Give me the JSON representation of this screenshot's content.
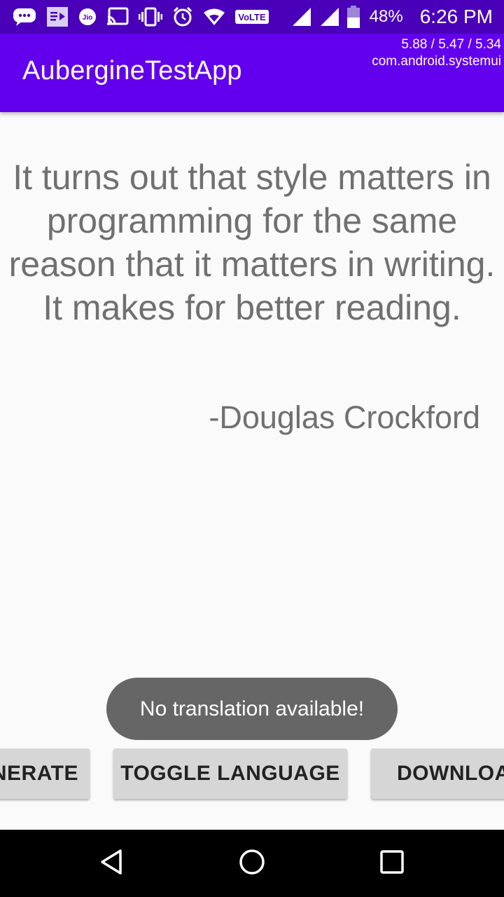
{
  "status_bar": {
    "icons": [
      "chat-bubble-icon",
      "media-playing-icon",
      "jio-icon",
      "cast-icon",
      "vibrate-icon",
      "alarm-icon",
      "wifi-icon",
      "volte-icon",
      "signal-icon",
      "signal-icon",
      "battery-icon"
    ],
    "volte_label": "VoLTE",
    "jio_label": "Jio",
    "battery_percent": "48%",
    "time": "6:26 PM",
    "color": "#4a00b8"
  },
  "app_bar": {
    "title": "AubergineTestApp",
    "color": "#6200ee",
    "cpu_load": "5.88 / 5.47 / 5.34",
    "cpu_process": "com.android.systemui"
  },
  "content": {
    "quote": "It turns out that style matters in programming for the same reason that it matters in writing. It makes for better reading.",
    "author": "-Douglas Crockford",
    "text_color": "#707070"
  },
  "toast": {
    "message": "No translation available!"
  },
  "buttons": {
    "generate_label": "NERATE",
    "toggle_label": "TOGGLE LANGUAGE",
    "download_label": "DOWNLOA"
  },
  "nav_bar": {
    "icons": [
      "back-icon",
      "home-icon",
      "recents-icon"
    ]
  }
}
